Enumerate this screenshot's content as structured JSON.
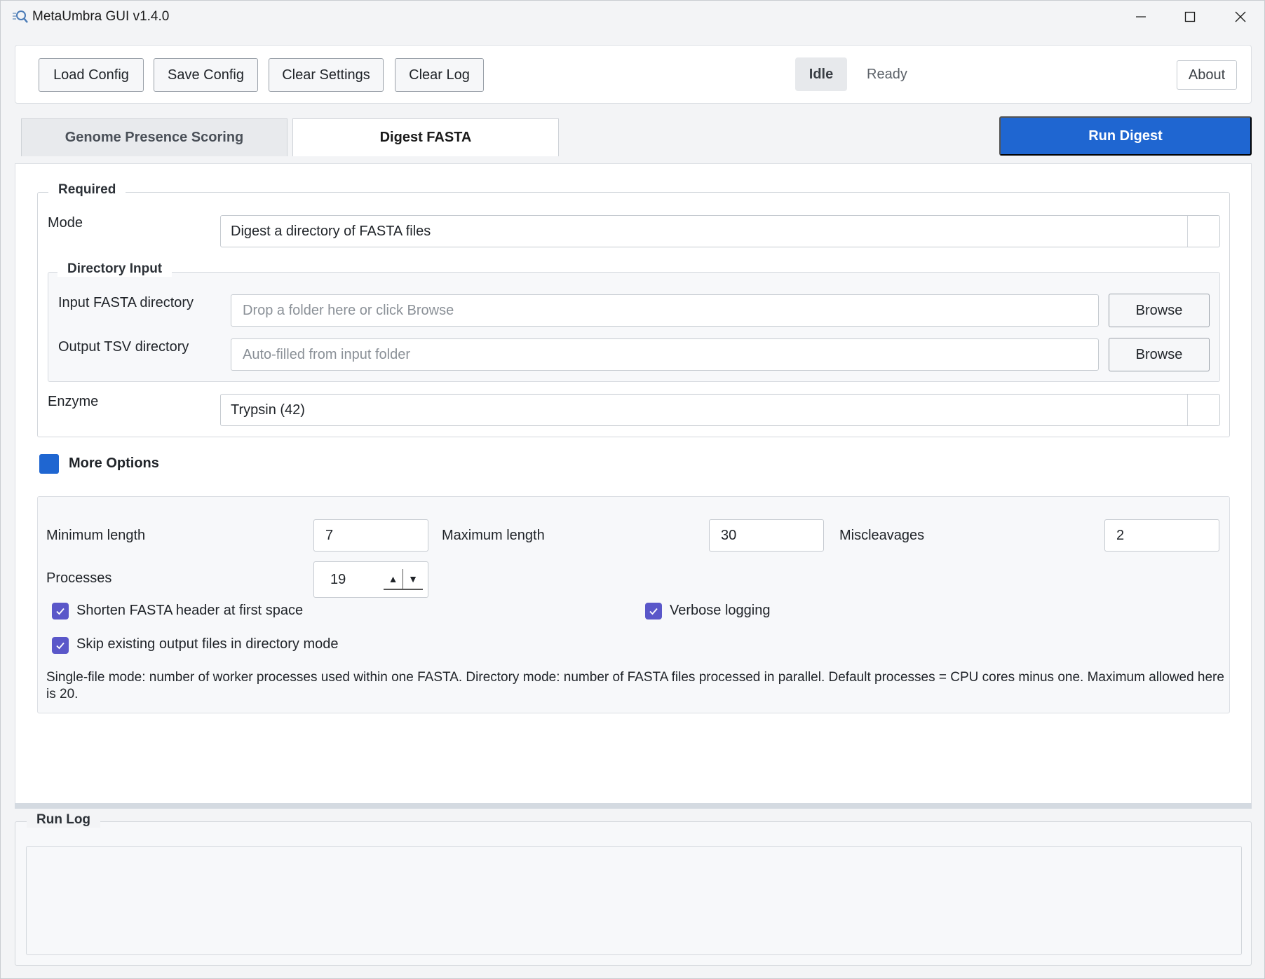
{
  "window": {
    "title": "MetaUmbra GUI v1.4.0"
  },
  "toolbar": {
    "load_config": "Load Config",
    "save_config": "Save Config",
    "clear_settings": "Clear Settings",
    "clear_log": "Clear Log",
    "status_pill": "Idle",
    "status_text": "Ready",
    "about": "About"
  },
  "tabs": [
    {
      "label": "Genome Presence Scoring",
      "active": false
    },
    {
      "label": "Digest FASTA",
      "active": true
    }
  ],
  "run_button": "Run Digest",
  "required": {
    "title": "Required",
    "mode_label": "Mode",
    "mode_value": "Digest a directory of FASTA files",
    "directory_input": {
      "title": "Directory Input",
      "input_label": "Input FASTA directory",
      "input_placeholder": "Drop a folder here or click Browse",
      "output_label": "Output TSV directory",
      "output_placeholder": "Auto-filled from input folder",
      "browse": "Browse"
    },
    "enzyme_label": "Enzyme",
    "enzyme_value": "Trypsin (42)"
  },
  "more_options": {
    "label": "More Options",
    "min_length_label": "Minimum length",
    "min_length_value": "7",
    "max_length_label": "Maximum length",
    "max_length_value": "30",
    "miscleavages_label": "Miscleavages",
    "miscleavages_value": "2",
    "processes_label": "Processes",
    "processes_value": "19",
    "checkboxes": [
      {
        "label": "Shorten FASTA header at first space",
        "checked": true
      },
      {
        "label": "Verbose logging",
        "checked": true
      },
      {
        "label": "Skip existing output files in directory mode",
        "checked": true
      }
    ],
    "help_text": "Single-file mode: number of worker processes used within one FASTA. Directory mode: number of FASTA files processed in parallel. Default processes = CPU cores minus one. Maximum allowed here is 20."
  },
  "run_log": {
    "title": "Run Log",
    "content": ""
  },
  "colors": {
    "accent": "#1f66d1",
    "checkbox": "#5a57c9"
  },
  "icons": {
    "app": "magnifier-icon",
    "minimize": "minimize-icon",
    "maximize": "maximize-icon",
    "close": "close-icon"
  }
}
